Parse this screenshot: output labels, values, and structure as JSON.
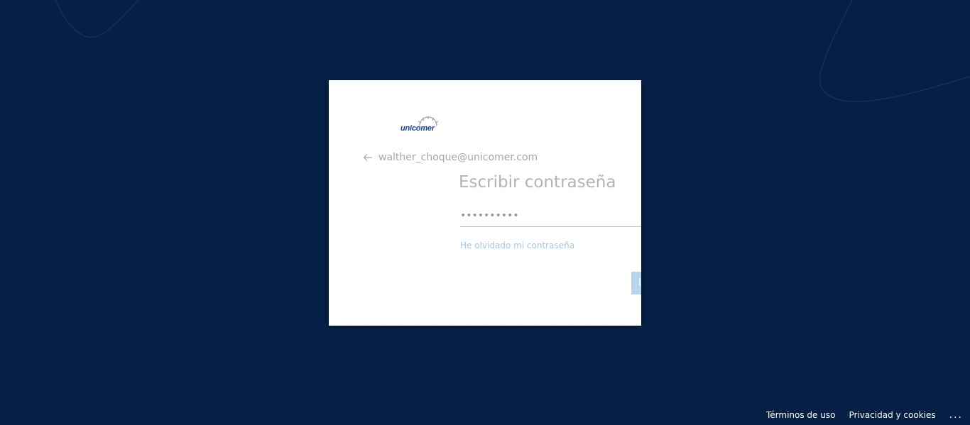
{
  "brand": {
    "name": "unicomer",
    "color": "#1c3f8f",
    "accent": "#9fc7e6",
    "background": "#051f45"
  },
  "login": {
    "identity_email": "walther_choque@unicomer.com",
    "title": "Escribir contraseña",
    "password_value": "••••••••••",
    "forgot_link": "He olvidado mi contraseña",
    "signin_label": "I"
  },
  "footer": {
    "terms": "Términos de uso",
    "privacy": "Privacidad y cookies",
    "more": "..."
  },
  "icons": {
    "back": "arrow-left-icon",
    "logo": "unicomer-logo"
  }
}
